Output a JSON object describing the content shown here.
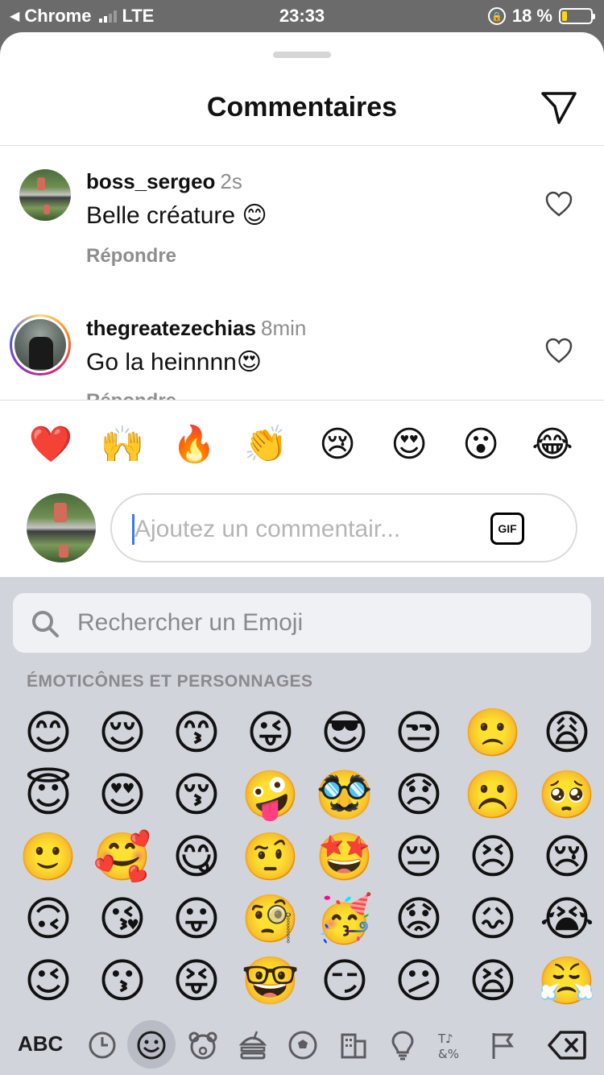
{
  "status_bar": {
    "back_app": "Chrome",
    "network": "LTE",
    "time": "23:33",
    "battery": "18 %",
    "battery_color": "#ffd60a"
  },
  "sheet": {
    "title": "Commentaires",
    "send_icon": "paper-plane-icon"
  },
  "comments": [
    {
      "username": "boss_sergeo",
      "time": "2s",
      "text": "Belle créature 😊",
      "reply_label": "Répondre"
    },
    {
      "username": "thegreatezechias",
      "time": "8min",
      "text": "Go la heinnnn😍",
      "reply_label": "Répondre"
    }
  ],
  "quick_emojis": [
    "❤️",
    "🙌",
    "🔥",
    "👏",
    "😢",
    "😍",
    "😮",
    "😂"
  ],
  "composer": {
    "placeholder": "Ajoutez un commentair...",
    "gif_label": "GIF"
  },
  "keyboard": {
    "search_placeholder": "Rechercher un Emoji",
    "section_title": "ÉMOTICÔNES ET PERSONNAGES",
    "emojis": [
      [
        "😊",
        "😌",
        "😙",
        "😜",
        "😎",
        "😒",
        "🙁",
        "😩"
      ],
      [
        "😇",
        "😍",
        "😚",
        "🤪",
        "🥸",
        "😞",
        "☹️",
        "🥺"
      ],
      [
        "🙂",
        "🥰",
        "😋",
        "🤨",
        "🤩",
        "😔",
        "😣",
        "😢"
      ],
      [
        "🙃",
        "😘",
        "😛",
        "🧐",
        "🥳",
        "😟",
        "😖",
        "😭"
      ],
      [
        "😉",
        "😗",
        "😝",
        "🤓",
        "😏",
        "😕",
        "😫",
        "😤"
      ]
    ],
    "abc_label": "ABC",
    "categories": [
      "clock-icon",
      "smiley-icon",
      "bear-icon",
      "burger-icon",
      "soccer-ball-icon",
      "building-icon",
      "lightbulb-icon",
      "symbols-icon",
      "flag-icon"
    ],
    "delete_icon": "backspace-icon"
  }
}
